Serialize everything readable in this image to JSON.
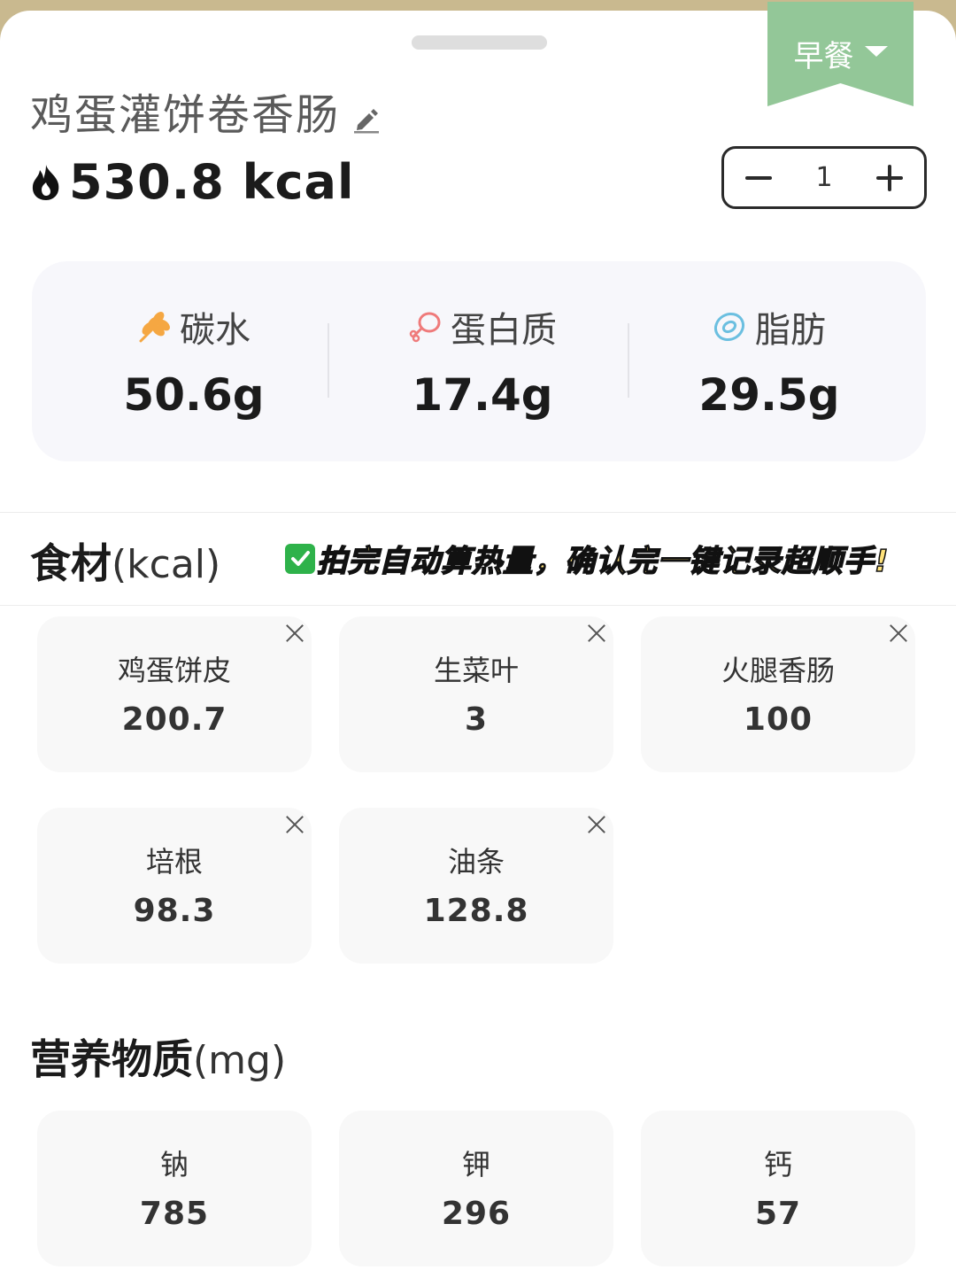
{
  "meal_selector": {
    "label": "早餐"
  },
  "food": {
    "title": "鸡蛋灌饼卷香肠",
    "calories": "530.8 kcal"
  },
  "quantity": {
    "value": "1"
  },
  "macros": [
    {
      "label": "碳水",
      "value": "50.6g",
      "icon": "wheat-icon",
      "color": "#f5a742"
    },
    {
      "label": "蛋白质",
      "value": "17.4g",
      "icon": "drumstick-icon",
      "color": "#ef7a7a"
    },
    {
      "label": "脂肪",
      "value": "29.5g",
      "icon": "fat-drop-icon",
      "color": "#6bbfe0"
    }
  ],
  "ingredients_section": {
    "heading": "食材",
    "unit": "(kcal)"
  },
  "promo_banner": {
    "text": "拍完自动算热量，确认完一键记录超顺手!"
  },
  "ingredients": [
    {
      "name": "鸡蛋饼皮",
      "kcal": "200.7"
    },
    {
      "name": "生菜叶",
      "kcal": "3"
    },
    {
      "name": "火腿香肠",
      "kcal": "100"
    },
    {
      "name": "培根",
      "kcal": "98.3"
    },
    {
      "name": "油条",
      "kcal": "128.8"
    }
  ],
  "nutrients_section": {
    "heading": "营养物质",
    "unit": "(mg)"
  },
  "nutrients": [
    {
      "name": "钠",
      "value": "785"
    },
    {
      "name": "钾",
      "value": "296"
    },
    {
      "name": "钙",
      "value": "57"
    }
  ]
}
